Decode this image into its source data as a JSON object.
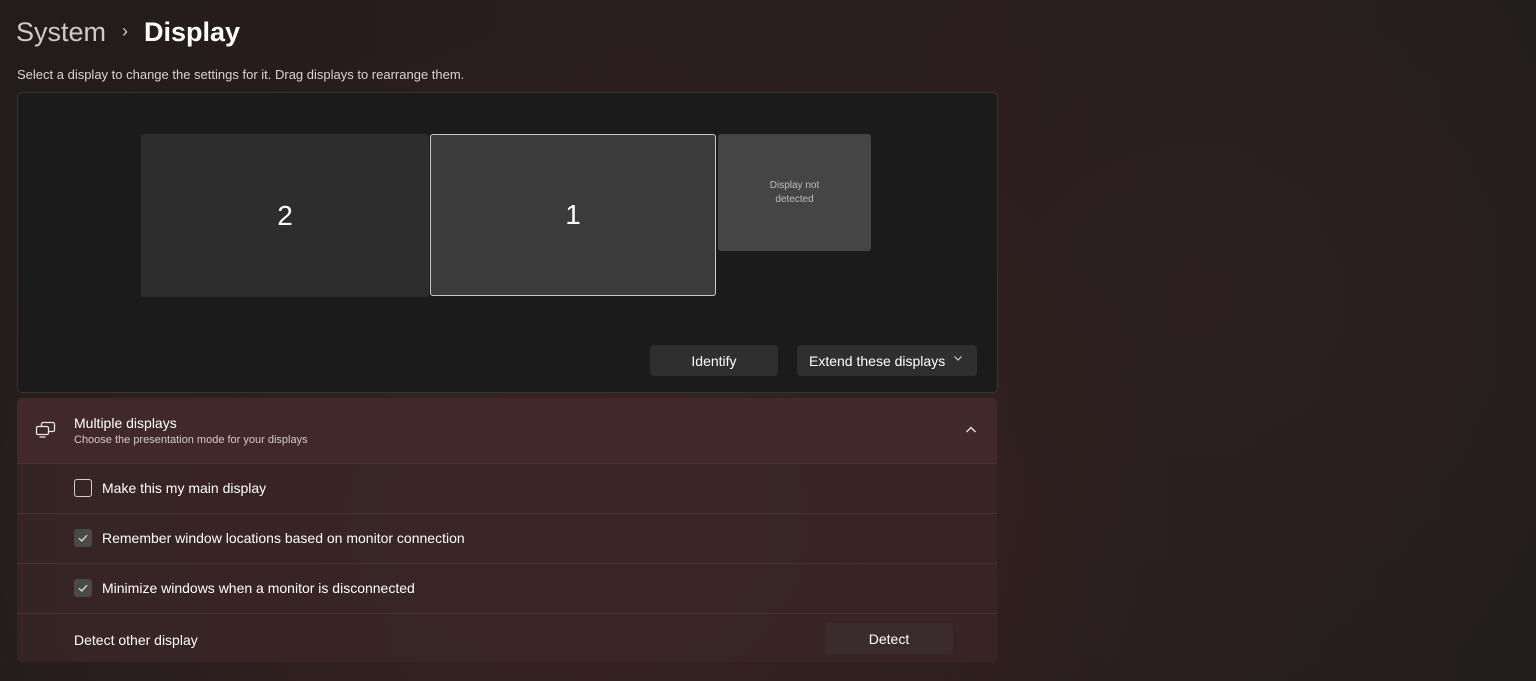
{
  "breadcrumb": {
    "parent": "System",
    "separator": "›",
    "current": "Display"
  },
  "hint": "Select a display to change the settings for it. Drag displays to rearrange them.",
  "arrangement": {
    "monitors": [
      {
        "label": "2",
        "selected": false
      },
      {
        "label": "1",
        "selected": true
      },
      {
        "label": "Display not detected",
        "selected": false
      }
    ],
    "identify_label": "Identify",
    "mode_dropdown": {
      "selected": "Extend these displays",
      "icon": "chevron-down-icon"
    }
  },
  "multiple_displays": {
    "icon": "multiple-displays-icon",
    "title": "Multiple displays",
    "subtitle": "Choose the presentation mode for your displays",
    "expanded": true,
    "options": [
      {
        "label": "Make this my main display",
        "checked": false
      },
      {
        "label": "Remember window locations based on monitor connection",
        "checked": true
      },
      {
        "label": "Minimize windows when a monitor is disconnected",
        "checked": true
      }
    ],
    "detect": {
      "label": "Detect other display",
      "button_label": "Detect"
    }
  },
  "colors": {
    "panel_dark": "#1b1b1b",
    "selected_border": "#c8c8c8",
    "accent_panel": "#3a2626"
  }
}
